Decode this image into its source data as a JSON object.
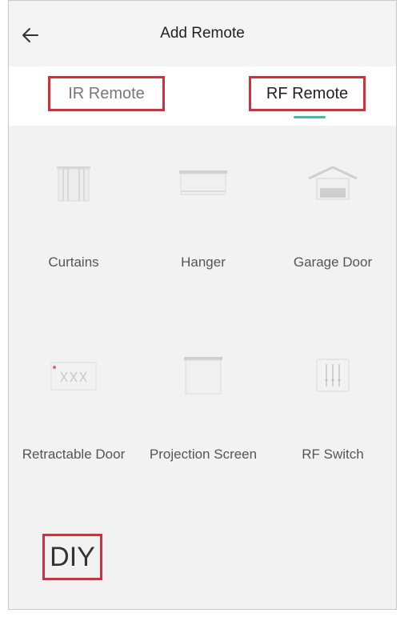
{
  "header": {
    "title": "Add Remote",
    "back_icon": "arrow-left-icon"
  },
  "tabs": [
    {
      "label": "IR Remote",
      "active": false
    },
    {
      "label": "RF Remote",
      "active": true
    }
  ],
  "colors": {
    "highlight_border": "#d32f3a",
    "active_tab_indicator": "#3bbf96",
    "background": "#f2f2f2"
  },
  "devices": [
    {
      "label": "Curtains",
      "icon": "curtains-icon"
    },
    {
      "label": "Hanger",
      "icon": "hanger-icon"
    },
    {
      "label": "Garage Door",
      "icon": "garage-door-icon"
    },
    {
      "label": "Retractable Door",
      "icon": "retractable-door-icon"
    },
    {
      "label": "Projection Screen",
      "icon": "projection-screen-icon"
    },
    {
      "label": "RF Switch",
      "icon": "rf-switch-icon"
    },
    {
      "label": "DIY",
      "icon": "diy"
    }
  ]
}
